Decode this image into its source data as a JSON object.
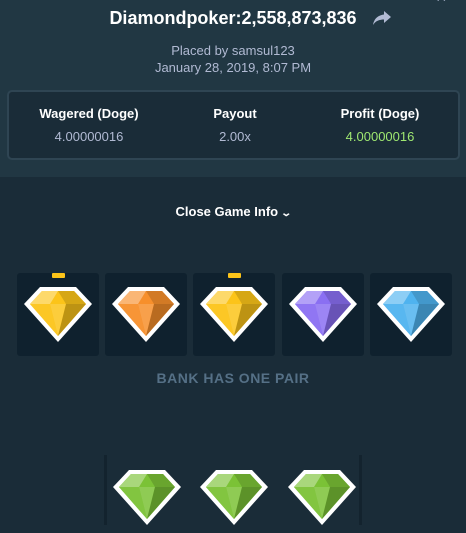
{
  "header": {
    "title": "Diamondpoker:2,558,873,836",
    "placed_by": "Placed by samsul123",
    "date": "January 28, 2019, 8:07 PM"
  },
  "stats": [
    {
      "label": "Wagered (Doge)",
      "value": "4.00000016"
    },
    {
      "label": "Payout",
      "value": "2.00x"
    },
    {
      "label": "Profit (Doge)",
      "value": "4.00000016"
    }
  ],
  "colors": {
    "profit": "#9fe871",
    "yellow": "#fcc419",
    "orange": "#f78f2b",
    "purple": "#8a6ff2",
    "blue": "#4fb3ef",
    "green": "#7bc236"
  },
  "toggle_label": "Close Game Info",
  "bank": {
    "gems": [
      "yellow",
      "orange",
      "yellow",
      "purple",
      "blue"
    ],
    "matched": [
      true,
      false,
      true,
      false,
      false
    ],
    "result": "BANK HAS ONE PAIR"
  },
  "player": {
    "gems": [
      "green",
      "green",
      "green"
    ]
  },
  "icons": [
    "share-icon",
    "close-icon",
    "chevron-down-icon",
    "gem-icon"
  ]
}
